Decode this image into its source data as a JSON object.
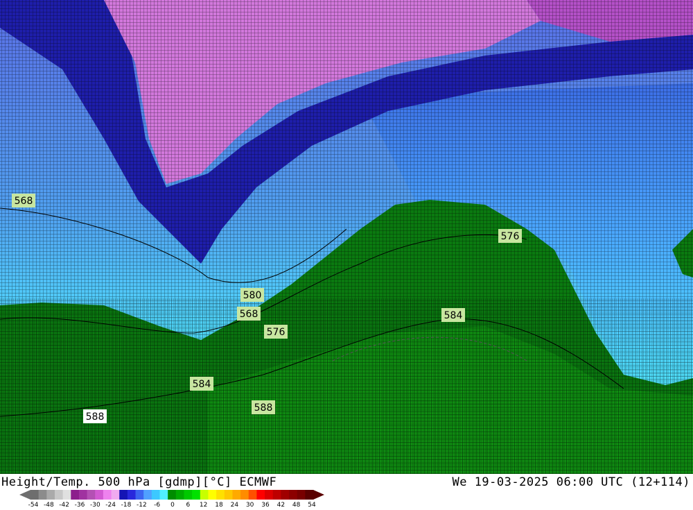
{
  "map": {
    "contour_labels": [
      "568",
      "576",
      "580",
      "568",
      "576",
      "584",
      "584",
      "588",
      "588"
    ]
  },
  "footer": {
    "title_left": "Height/Temp. 500 hPa [gdmp][°C] ECMWF",
    "title_right": "We 19-03-2025 06:00 UTC (12+114)"
  },
  "legend": {
    "colors": [
      "#6e6e6e",
      "#8c8c8c",
      "#aaaaaa",
      "#c8c8c8",
      "#e0e0e0",
      "#8c1e8c",
      "#a032a0",
      "#b450b4",
      "#d25ad2",
      "#ee82ee",
      "#f0aaf0",
      "#1414b4",
      "#2828dc",
      "#3c64f0",
      "#50a0ff",
      "#3cc8ff",
      "#50f0ff",
      "#008c00",
      "#00aa00",
      "#00c800",
      "#00e100",
      "#c8ff00",
      "#ffff00",
      "#ffe100",
      "#ffc800",
      "#ffaa00",
      "#ff8c00",
      "#ff5000",
      "#ff0000",
      "#dc0000",
      "#be0000",
      "#a00000",
      "#8c0000",
      "#780000",
      "#5a0000"
    ],
    "ticks": [
      "-54",
      "-48",
      "-42",
      "-36",
      "-30",
      "-24",
      "-18",
      "-12",
      "-6",
      "0",
      "6",
      "12",
      "18",
      "24",
      "30",
      "36",
      "42",
      "48",
      "54"
    ]
  }
}
